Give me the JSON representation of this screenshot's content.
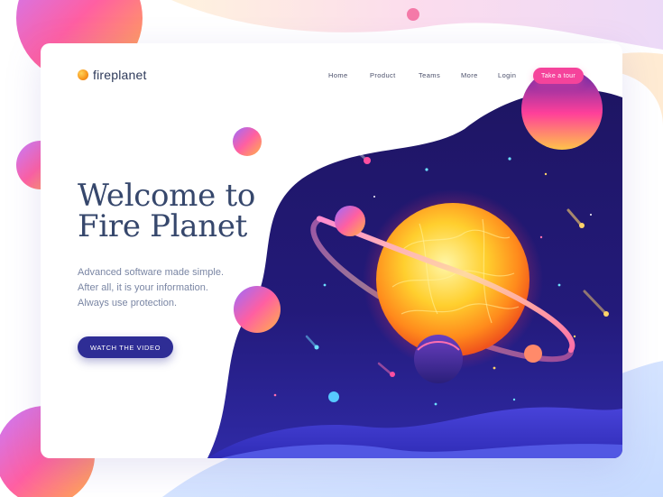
{
  "brand": {
    "name": "fireplanet",
    "logo_icon": "planet-logo-icon"
  },
  "nav": {
    "items": [
      {
        "label": "Home"
      },
      {
        "label": "Product"
      },
      {
        "label": "Teams"
      },
      {
        "label": "More"
      },
      {
        "label": "Login"
      }
    ],
    "cta_label": "Take a tour"
  },
  "hero": {
    "title_line1": "Welcome to",
    "title_line2": "Fire Planet",
    "description": [
      "Advanced software made simple.",
      "After all, it is your information.",
      "Always use protection."
    ],
    "button_label": "WATCH THE VIDEO"
  },
  "colors": {
    "accent_pink": "#f5439b",
    "button_navy": "#2e2d95",
    "heading": "#36476c",
    "body_text": "#7a86a4",
    "space_bg": "#1d1769"
  }
}
